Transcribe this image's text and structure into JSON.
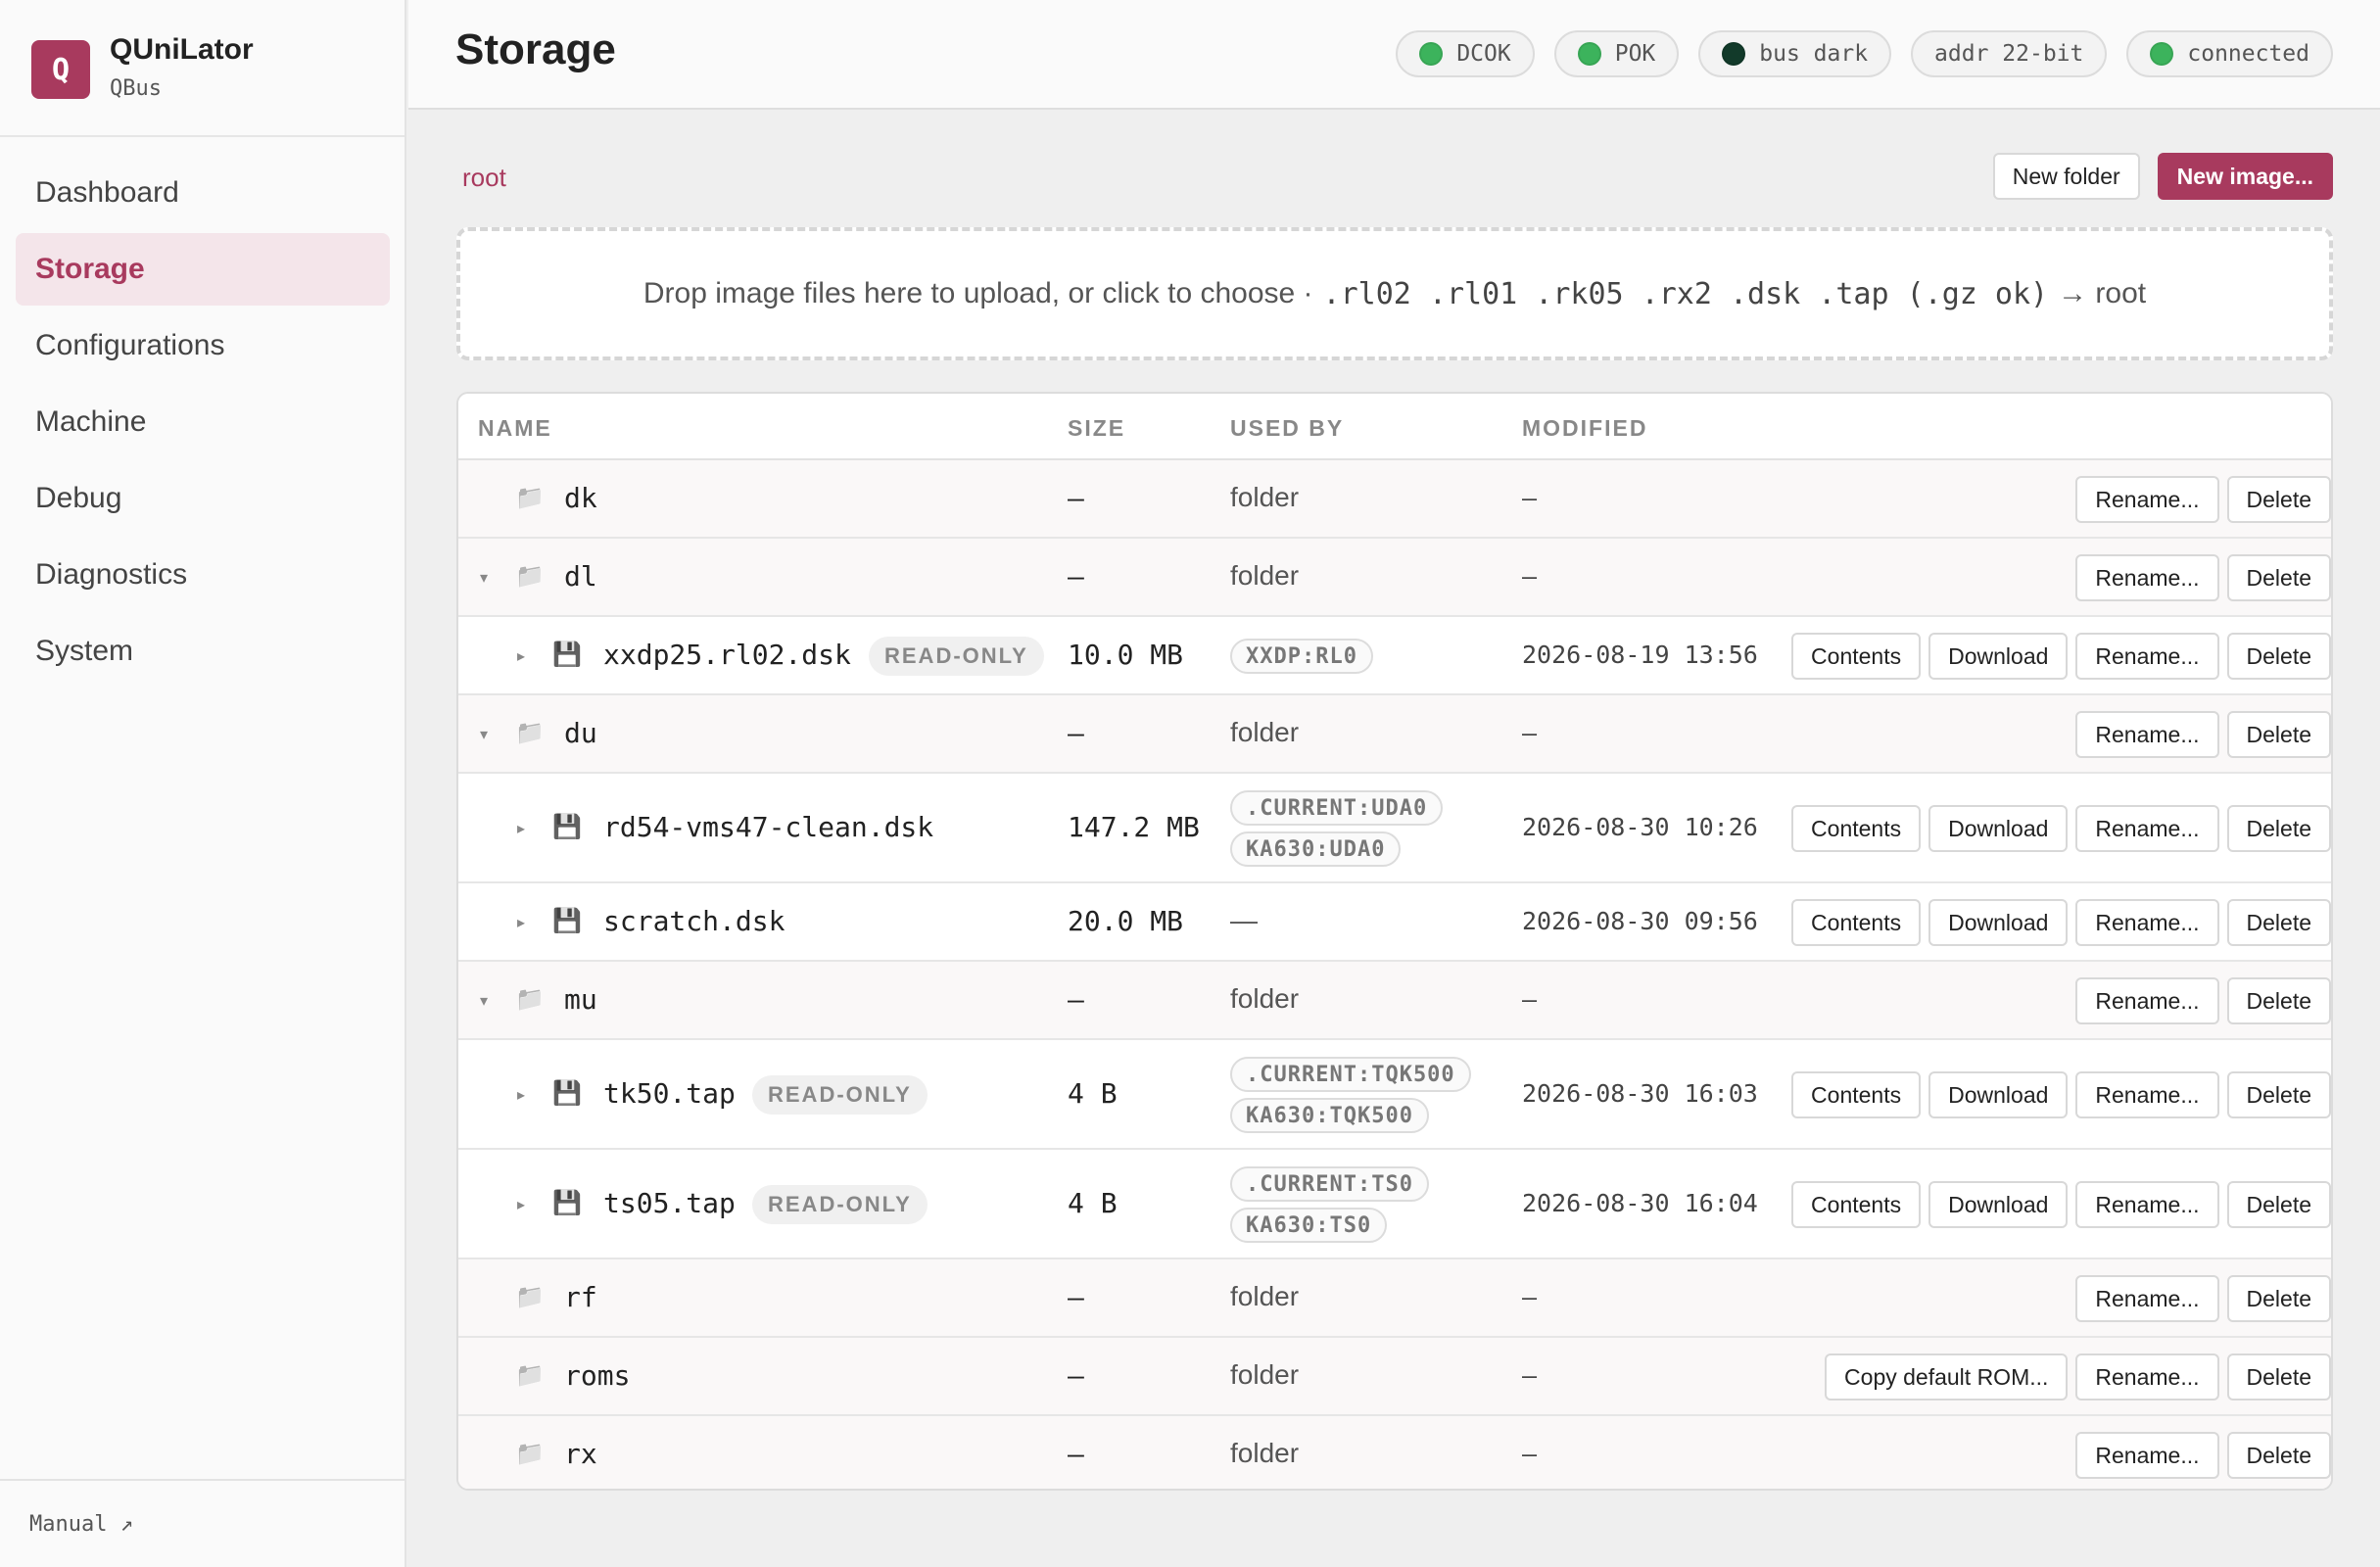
{
  "app": {
    "logo_letter": "Q",
    "name": "QUniLator",
    "subtitle": "QBus"
  },
  "nav": {
    "items": [
      {
        "label": "Dashboard",
        "active": false
      },
      {
        "label": "Storage",
        "active": true
      },
      {
        "label": "Configurations",
        "active": false
      },
      {
        "label": "Machine",
        "active": false
      },
      {
        "label": "Debug",
        "active": false
      },
      {
        "label": "Diagnostics",
        "active": false
      },
      {
        "label": "System",
        "active": false
      }
    ],
    "footer_link": "Manual ↗"
  },
  "header": {
    "title": "Storage",
    "status_pills": [
      {
        "label": "DCOK",
        "dot_color": "#3cb35c"
      },
      {
        "label": "POK",
        "dot_color": "#3cb35c"
      },
      {
        "label": "bus dark",
        "dot_color": "#123a2a"
      },
      {
        "label": "addr 22-bit",
        "dot_color": null
      },
      {
        "label": "connected",
        "dot_color": "#3cb35c"
      }
    ]
  },
  "breadcrumb": "root",
  "toolbar": {
    "new_folder": "New folder",
    "new_image": "New image..."
  },
  "dropzone": {
    "text": "Drop image files here to upload, or click to choose ·",
    "extensions": ".rl02 .rl01 .rk05 .rx2 .dsk .tap (.gz ok)",
    "target": "→ root"
  },
  "table": {
    "headers": {
      "name": "NAME",
      "size": "SIZE",
      "used_by": "USED BY",
      "modified": "MODIFIED"
    },
    "action_labels": {
      "contents": "Contents",
      "download": "Download",
      "rename": "Rename...",
      "delete": "Delete",
      "copy_roms": "Copy default ROM..."
    },
    "read_only_label": "READ-ONLY",
    "rows": [
      {
        "type": "folder",
        "name": "dk",
        "size": "—",
        "used_by": "folder",
        "modified": "—",
        "expanded": false
      },
      {
        "type": "folder",
        "name": "dl",
        "size": "—",
        "used_by": "folder",
        "modified": "—",
        "expanded": true
      },
      {
        "type": "file",
        "name": "xxdp25.rl02.dsk",
        "read_only": true,
        "size": "10.0 MB",
        "used_by": [
          "XXDP:RL0"
        ],
        "modified": "2026-08-19 13:56"
      },
      {
        "type": "folder",
        "name": "du",
        "size": "—",
        "used_by": "folder",
        "modified": "—",
        "expanded": true
      },
      {
        "type": "file",
        "name": "rd54-vms47-clean.dsk",
        "read_only": false,
        "size": "147.2 MB",
        "used_by": [
          ".CURRENT:UDA0",
          "KA630:UDA0"
        ],
        "modified": "2026-08-30 10:26"
      },
      {
        "type": "file",
        "name": "scratch.dsk",
        "read_only": false,
        "size": "20.0 MB",
        "used_by": "—",
        "modified": "2026-08-30 09:56"
      },
      {
        "type": "folder",
        "name": "mu",
        "size": "—",
        "used_by": "folder",
        "modified": "—",
        "expanded": true
      },
      {
        "type": "file",
        "name": "tk50.tap",
        "read_only": true,
        "size": "4 B",
        "used_by": [
          ".CURRENT:TQK500",
          "KA630:TQK500"
        ],
        "modified": "2026-08-30 16:03"
      },
      {
        "type": "file",
        "name": "ts05.tap",
        "read_only": true,
        "size": "4 B",
        "used_by": [
          ".CURRENT:TS0",
          "KA630:TS0"
        ],
        "modified": "2026-08-30 16:04"
      },
      {
        "type": "folder",
        "name": "rf",
        "size": "—",
        "used_by": "folder",
        "modified": "—",
        "expanded": false
      },
      {
        "type": "folder",
        "name": "roms",
        "size": "—",
        "used_by": "folder",
        "modified": "—",
        "expanded": false,
        "copy_roms": true
      },
      {
        "type": "folder",
        "name": "rx",
        "size": "—",
        "used_by": "folder",
        "modified": "—",
        "expanded": false
      }
    ]
  }
}
